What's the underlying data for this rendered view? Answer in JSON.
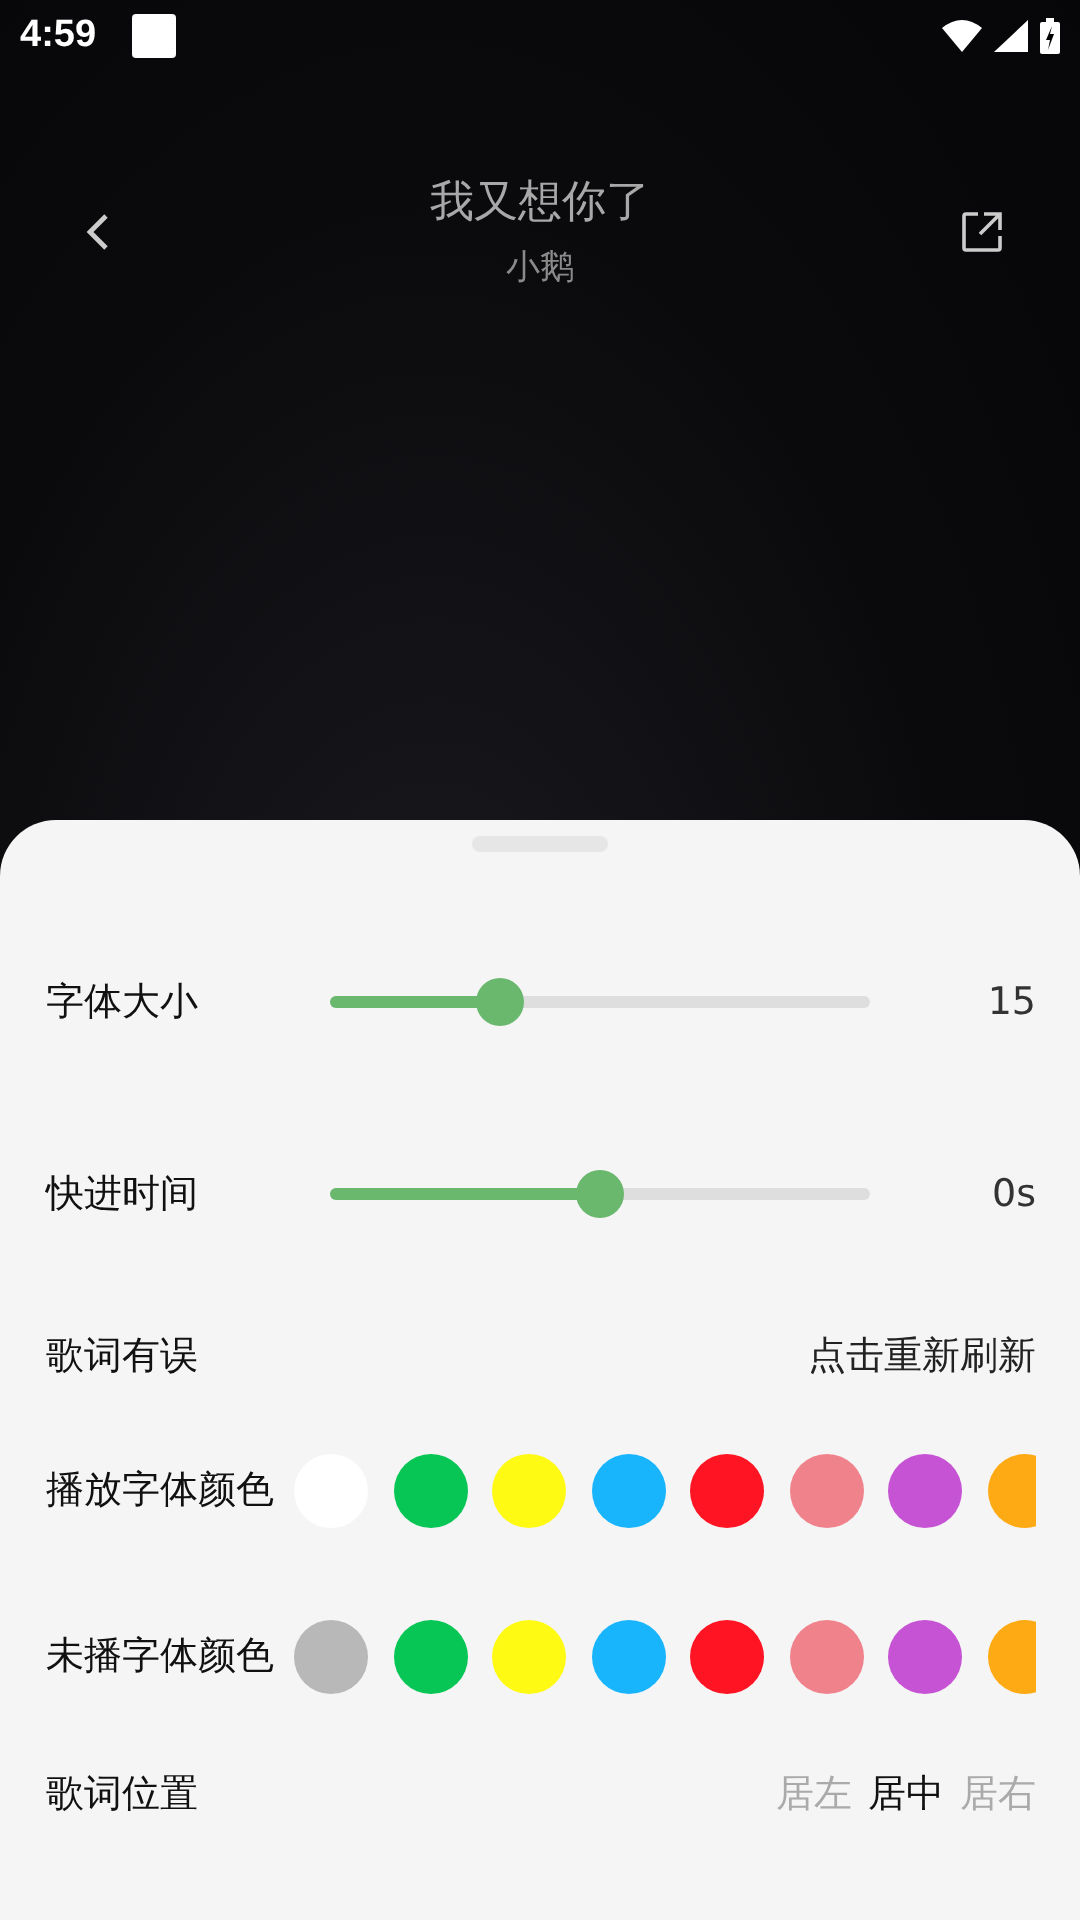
{
  "status_bar": {
    "time": "4:59"
  },
  "header": {
    "title": "我又想你了",
    "artist": "小鹅"
  },
  "sliders": [
    {
      "label": "字体大小",
      "level": 0.33,
      "reading": "15"
    },
    {
      "label": "快进时间",
      "level": 0.5,
      "reading": "0s"
    }
  ],
  "lyrics_error": {
    "label": "歌词有误",
    "action": "点击重新刷新"
  },
  "color_rows": [
    {
      "label": "播放字体颜色",
      "swatches": [
        {
          "color": "#ffffff"
        },
        {
          "color": "#08c655"
        },
        {
          "color": "#fefa14"
        },
        {
          "color": "#18b5fd"
        },
        {
          "color": "#fe1423"
        },
        {
          "color": "#f0828c"
        },
        {
          "color": "#c652d4"
        },
        {
          "color": "#feaa14"
        }
      ]
    },
    {
      "label": "未播字体颜色",
      "swatches": [
        {
          "color": "#b8b8b8"
        },
        {
          "color": "#08c655"
        },
        {
          "color": "#fefa14"
        },
        {
          "color": "#18b5fd"
        },
        {
          "color": "#fe1423"
        },
        {
          "color": "#f0828c"
        },
        {
          "color": "#c652d4"
        },
        {
          "color": "#feaa14"
        }
      ]
    }
  ],
  "position": {
    "label": "歌词位置",
    "options": [
      {
        "label": "居左",
        "selected": false
      },
      {
        "label": "居中",
        "selected": true
      },
      {
        "label": "居右",
        "selected": false
      }
    ]
  }
}
